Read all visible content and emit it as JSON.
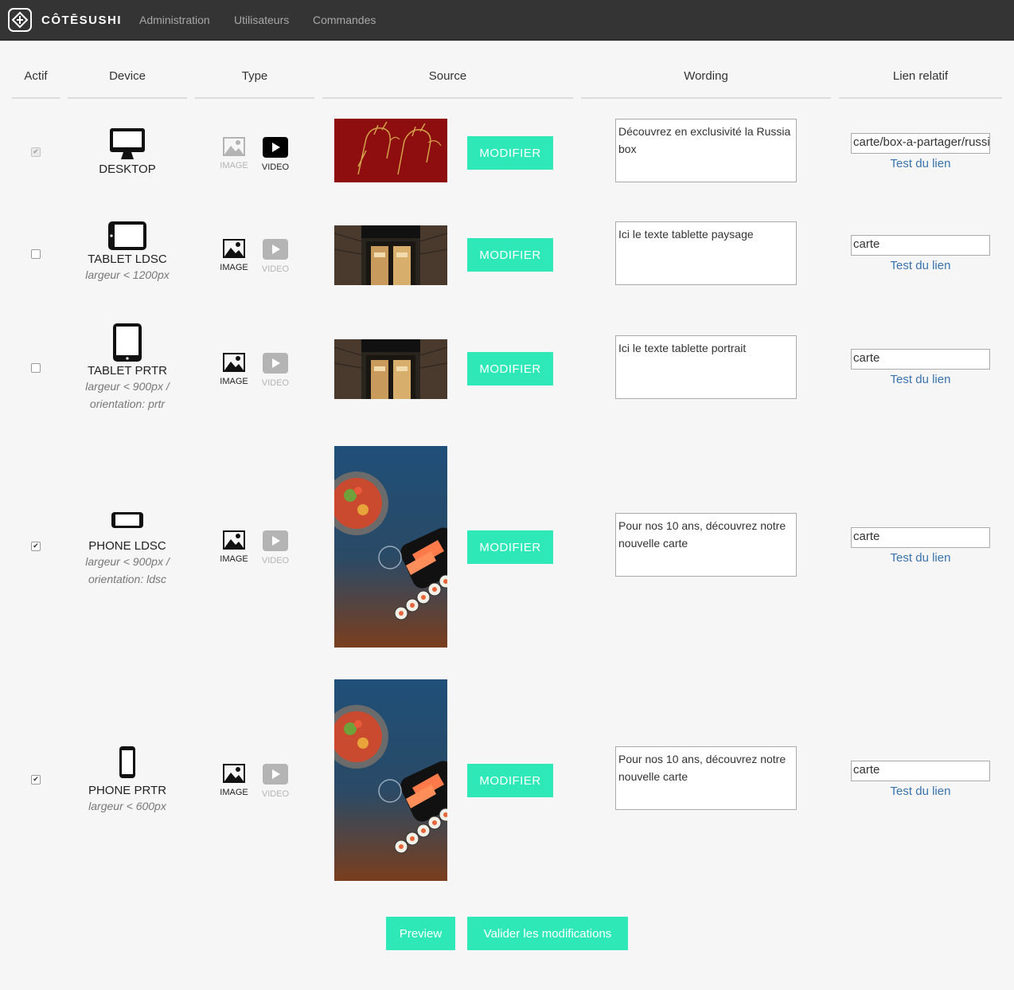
{
  "navbar": {
    "brand": "CÔTĒSUSHI",
    "links": [
      "Administration",
      "Utilisateurs",
      "Commandes"
    ]
  },
  "table": {
    "headers": [
      "Actif",
      "Device",
      "Type",
      "Source",
      "Wording",
      "Lien relatif"
    ],
    "rows": [
      {
        "active": true,
        "active_disabled": true,
        "device": "DESKTOP",
        "desc1": "",
        "desc2": "",
        "type_image": "IMAGE",
        "type_video": "VIDEO",
        "selected_type": "video",
        "modify_label": "MODIFIER",
        "wording": "Découvrez en exclusivité la Russia box",
        "link": "carte/box-a-partager/russia",
        "test_link": "Test du lien"
      },
      {
        "active": false,
        "active_disabled": false,
        "device": "TABLET LDSC",
        "desc1": "largeur < 1200px",
        "desc2": "",
        "type_image": "IMAGE",
        "type_video": "VIDEO",
        "selected_type": "image",
        "modify_label": "MODIFIER",
        "wording": "Ici le texte tablette paysage",
        "link": "carte",
        "test_link": "Test du lien"
      },
      {
        "active": false,
        "active_disabled": false,
        "device": "TABLET PRTR",
        "desc1": "largeur < 900px /",
        "desc2": "orientation: prtr",
        "type_image": "IMAGE",
        "type_video": "VIDEO",
        "selected_type": "image",
        "modify_label": "MODIFIER",
        "wording": "Ici le texte tablette portrait",
        "link": "carte",
        "test_link": "Test du lien"
      },
      {
        "active": true,
        "active_disabled": false,
        "device": "PHONE LDSC",
        "desc1": "largeur < 900px /",
        "desc2": "orientation: ldsc",
        "type_image": "IMAGE",
        "type_video": "VIDEO",
        "selected_type": "image",
        "modify_label": "MODIFIER",
        "wording": "Pour nos 10 ans, découvrez notre nouvelle carte",
        "link": "carte",
        "test_link": "Test du lien"
      },
      {
        "active": true,
        "active_disabled": false,
        "device": "PHONE PRTR",
        "desc1": "largeur < 600px",
        "desc2": "",
        "type_image": "IMAGE",
        "type_video": "VIDEO",
        "selected_type": "image",
        "modify_label": "MODIFIER",
        "wording": "Pour nos 10 ans, découvrez notre nouvelle carte",
        "link": "carte",
        "test_link": "Test du lien"
      }
    ]
  },
  "actions": {
    "preview": "Preview",
    "validate": "Valider les modifications"
  },
  "colors": {
    "accent": "#2ee8b8",
    "navbar": "#343434",
    "link": "#3973ad"
  }
}
